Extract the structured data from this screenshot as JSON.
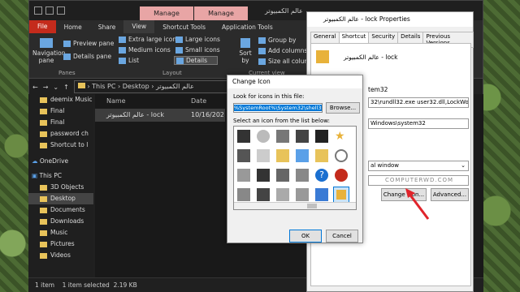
{
  "explorer": {
    "title": "عالم الكمبيوتر",
    "tabs": [
      "File",
      "Home",
      "Share",
      "View",
      "Shortcut Tools",
      "Application Tools"
    ],
    "manage_labels": [
      "Manage",
      "Manage"
    ],
    "ribbon": {
      "nav_pane": "Navigation pane",
      "preview_pane": "Preview pane",
      "details_pane": "Details pane",
      "panes_label": "Panes",
      "extra_large": "Extra large icons",
      "large": "Large icons",
      "medium": "Medium icons",
      "small": "Small icons",
      "list": "List",
      "details": "Details",
      "layout_label": "Layout",
      "sort_by": "Sort by",
      "group_by": "Group by",
      "add_columns": "Add columns",
      "size_all": "Size all columns",
      "current_view_label": "Current view"
    },
    "address": [
      "This PC",
      "Desktop",
      "عالم الكمبيوتر"
    ],
    "nav_items": [
      {
        "label": "deemix Music"
      },
      {
        "label": "Final"
      },
      {
        "label": "Final"
      },
      {
        "label": "password ch"
      },
      {
        "label": "Shortcut to l"
      },
      {
        "label": "OneDrive"
      },
      {
        "label": "This PC"
      },
      {
        "label": "3D Objects"
      },
      {
        "label": "Desktop"
      },
      {
        "label": "Documents"
      },
      {
        "label": "Downloads"
      },
      {
        "label": "Music"
      },
      {
        "label": "Pictures"
      },
      {
        "label": "Videos"
      }
    ],
    "columns": {
      "name": "Name",
      "date": "Date"
    },
    "file": {
      "name": "عالم الكمبيوتر - lock",
      "date": "10/16/202"
    },
    "status": {
      "count": "1 item",
      "selected": "1 item selected",
      "size": "2.19 KB"
    }
  },
  "properties": {
    "title": "عالم الكمبيوتر - lock Properties",
    "tabs": [
      "General",
      "Shortcut",
      "Security",
      "Details",
      "Previous Versions"
    ],
    "name": "عالم الكمبيوتر - lock",
    "target_type": "tem32",
    "target": "32\\rundll32.exe user32.dll,LockWorkStation",
    "start_in": "Windows\\system32",
    "run": "al window",
    "comment": "COMPUTERWD.COM",
    "buttons": {
      "change_icon": "Change Icon...",
      "advanced": "Advanced..."
    }
  },
  "change_icon": {
    "title": "Change Icon",
    "look_for_label": "Look for icons in this file:",
    "path": "%SystemRoot%\\System32\\shell32.dll",
    "browse": "Browse...",
    "select_label": "Select an icon from the list below:",
    "ok": "OK",
    "cancel": "Cancel"
  },
  "colors": {
    "file_tab": "#c42b1c",
    "manage_tab": "#e8a5a5",
    "selection": "#0078d7",
    "arrow": "#e0242b"
  }
}
